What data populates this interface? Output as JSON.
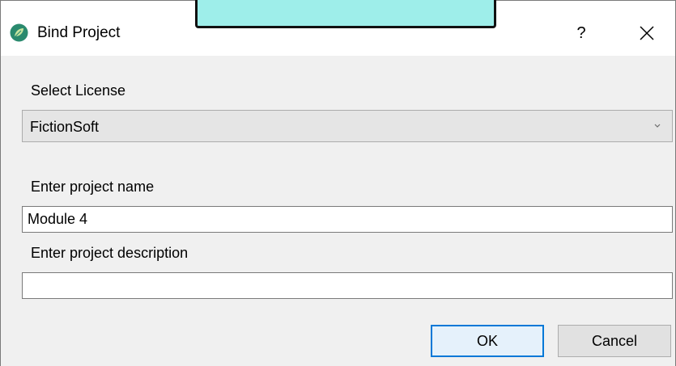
{
  "window": {
    "title": "Bind Project",
    "help_label": "?",
    "close_icon": "close-icon",
    "app_icon": "leaf-icon"
  },
  "license": {
    "label": "Select License",
    "selected": "FictionSoft"
  },
  "project_name": {
    "label": "Enter project name",
    "value": "Module 4"
  },
  "project_description": {
    "label": "Enter project description",
    "value": ""
  },
  "buttons": {
    "ok": "OK",
    "cancel": "Cancel"
  },
  "colors": {
    "accent": "#0078d7",
    "overlay": "#9eeeea",
    "icon": "#2a8a6e"
  }
}
